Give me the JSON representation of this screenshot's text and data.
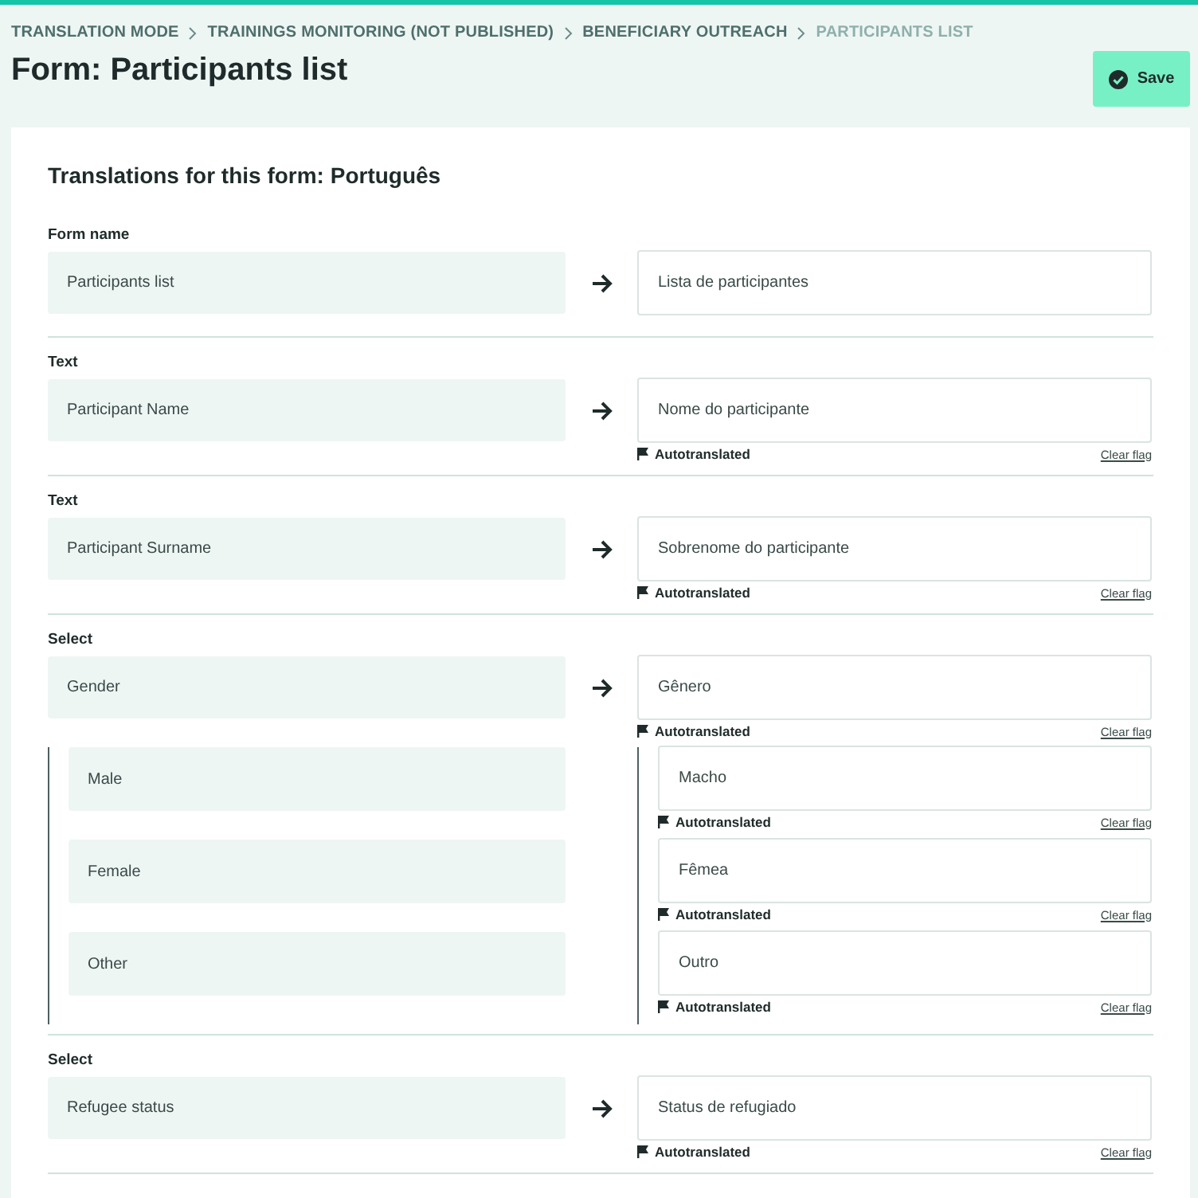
{
  "breadcrumb": [
    {
      "label": "TRANSLATION MODE",
      "current": false
    },
    {
      "label": "TRAININGS MONITORING (NOT PUBLISHED)",
      "current": false
    },
    {
      "label": "BENEFICIARY OUTREACH",
      "current": false
    },
    {
      "label": "PARTICIPANTS LIST",
      "current": true
    }
  ],
  "title": "Form: Participants list",
  "save_button": "Save",
  "card_title": "Translations for this form: Português",
  "sections": [
    {
      "kind": "form_name",
      "type_label": "Form name",
      "source": "Participants list",
      "translation": "Lista de participantes"
    },
    {
      "kind": "text",
      "type_label": "Text",
      "source": "Participant Name",
      "translation": "Nome do participante",
      "flag": {
        "label": "Autotranslated",
        "action": "Clear flag"
      }
    },
    {
      "kind": "text",
      "type_label": "Text",
      "source": "Participant Surname",
      "translation": "Sobrenome do participante",
      "flag": {
        "label": "Autotranslated",
        "action": "Clear flag"
      }
    },
    {
      "kind": "select",
      "type_label": "Select",
      "source": "Gender",
      "translation": "Gênero",
      "flag": {
        "label": "Autotranslated",
        "action": "Clear flag"
      },
      "options": [
        {
          "source": "Male",
          "translation": "Macho",
          "flag": {
            "label": "Autotranslated",
            "action": "Clear flag"
          }
        },
        {
          "source": "Female",
          "translation": "Fêmea",
          "flag": {
            "label": "Autotranslated",
            "action": "Clear flag"
          }
        },
        {
          "source": "Other",
          "translation": "Outro",
          "flag": {
            "label": "Autotranslated",
            "action": "Clear flag"
          }
        }
      ]
    },
    {
      "kind": "select",
      "type_label": "Select",
      "source": "Refugee status",
      "translation": "Status de refugiado",
      "flag": {
        "label": "Autotranslated",
        "action": "Clear flag"
      }
    }
  ]
}
